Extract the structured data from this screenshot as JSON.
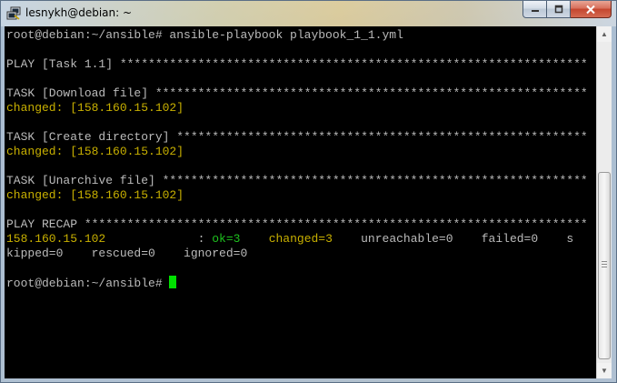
{
  "window": {
    "title": "lesnykh@debian: ~",
    "app_icon": "putty-icon",
    "controls": {
      "minimize": "minimize-icon",
      "maximize": "maximize-icon",
      "close": "close-icon"
    }
  },
  "terminal": {
    "lines": [
      [
        {
          "t": "root@debian:~/ansible# ansible-playbook playbook_1_1.yml",
          "c": "w"
        }
      ],
      [],
      [
        {
          "t": "PLAY [Task 1.1] ******************************************************************",
          "c": "w"
        }
      ],
      [],
      [
        {
          "t": "TASK [Download file] *************************************************************",
          "c": "w"
        }
      ],
      [
        {
          "t": "changed: [158.160.15.102]",
          "c": "y"
        }
      ],
      [],
      [
        {
          "t": "TASK [Create directory] **********************************************************",
          "c": "w"
        }
      ],
      [
        {
          "t": "changed: [158.160.15.102]",
          "c": "y"
        }
      ],
      [],
      [
        {
          "t": "TASK [Unarchive file] ************************************************************",
          "c": "w"
        }
      ],
      [
        {
          "t": "changed: [158.160.15.102]",
          "c": "y"
        }
      ],
      [],
      [
        {
          "t": "PLAY RECAP ***********************************************************************",
          "c": "w"
        }
      ],
      [
        {
          "t": "158.160.15.102",
          "c": "y"
        },
        {
          "t": "             : ",
          "c": "w"
        },
        {
          "t": "ok=3",
          "c": "g"
        },
        {
          "t": "    ",
          "c": "w"
        },
        {
          "t": "changed=3",
          "c": "y"
        },
        {
          "t": "    unreachable=0    failed=0    s",
          "c": "w"
        }
      ],
      [
        {
          "t": "kipped=0    rescued=0    ignored=0",
          "c": "w"
        }
      ],
      [],
      [
        {
          "t": "root@debian:~/ansible# ",
          "c": "w"
        }
      ]
    ],
    "cursor_line": 17
  },
  "colors": {
    "terminal_bg": "#000000",
    "text": "#bbbbbb",
    "changed_yellow": "#c8b000",
    "ok_green": "#1ec21e",
    "cursor": "#00e000"
  }
}
